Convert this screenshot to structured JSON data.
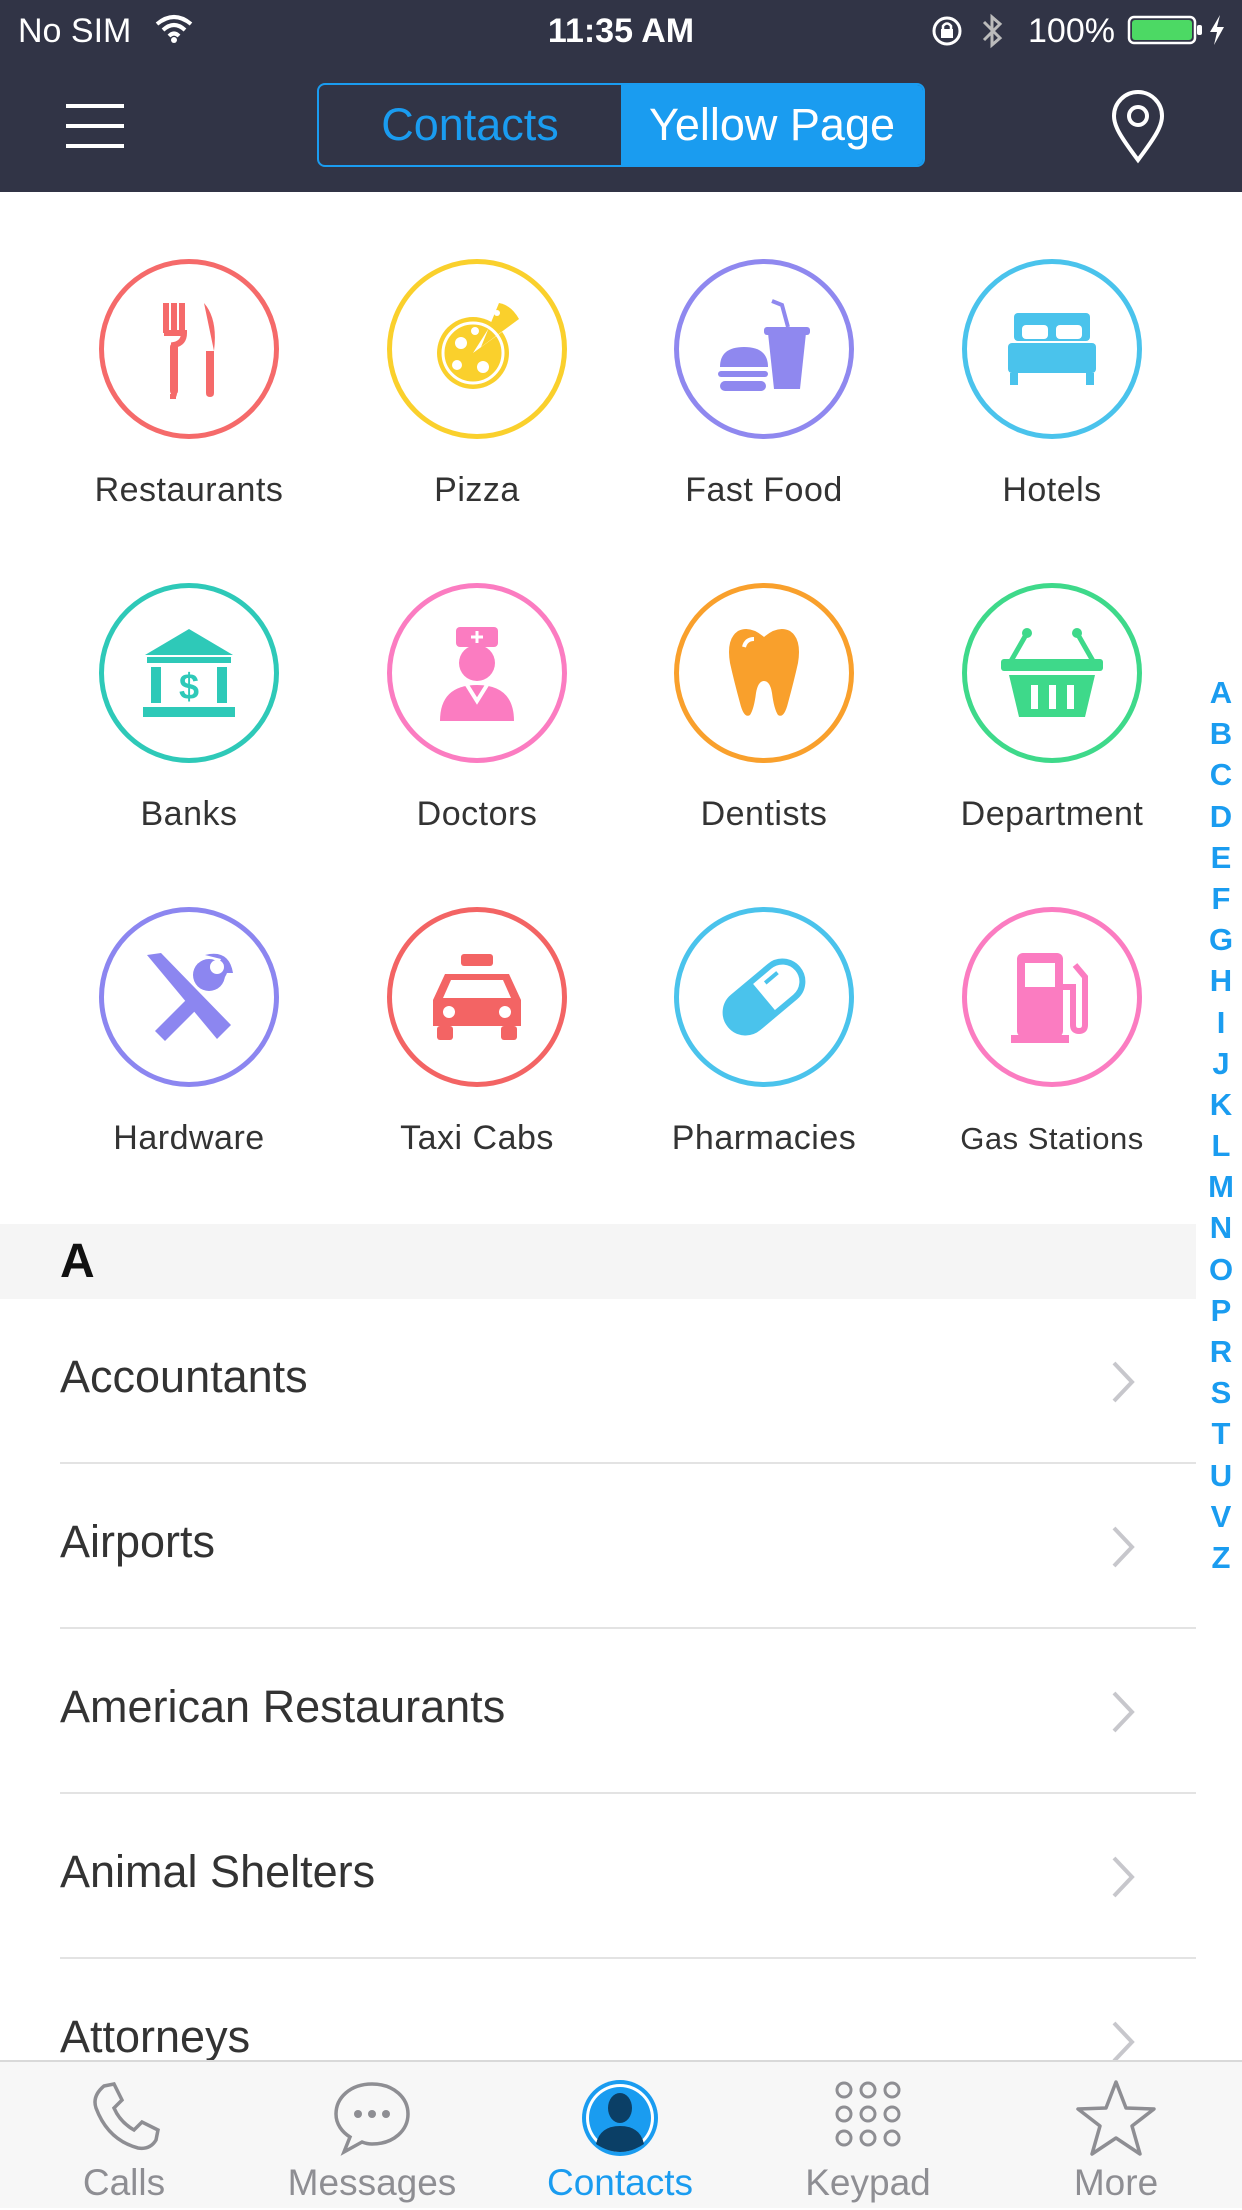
{
  "status_bar": {
    "carrier": "No SIM",
    "time": "11:35 AM",
    "battery": "100%"
  },
  "header": {
    "segments": [
      {
        "label": "Contacts",
        "selected": false
      },
      {
        "label": "Yellow Page",
        "selected": true
      }
    ]
  },
  "categories": [
    {
      "label": "Restaurants",
      "icon": "fork-knife-icon",
      "color": "#f56a6a"
    },
    {
      "label": "Pizza",
      "icon": "pizza-icon",
      "color": "#fad02c"
    },
    {
      "label": "Fast Food",
      "icon": "burger-drink-icon",
      "color": "#8f88ef"
    },
    {
      "label": "Hotels",
      "icon": "bed-icon",
      "color": "#4ac3ec"
    },
    {
      "label": "Banks",
      "icon": "bank-icon",
      "color": "#2ec9b8"
    },
    {
      "label": "Doctors",
      "icon": "nurse-icon",
      "color": "#fb7cc1"
    },
    {
      "label": "Dentists",
      "icon": "tooth-icon",
      "color": "#f9a02c"
    },
    {
      "label": "Department",
      "icon": "basket-icon",
      "color": "#3ed98a"
    },
    {
      "label": "Hardware",
      "icon": "tools-icon",
      "color": "#8c86f0"
    },
    {
      "label": "Taxi Cabs",
      "icon": "taxi-icon",
      "color": "#f36464"
    },
    {
      "label": "Pharmacies",
      "icon": "pill-icon",
      "color": "#4ac3ec"
    },
    {
      "label": "Gas Stations",
      "icon": "gas-pump-icon",
      "color": "#fb7cc1"
    }
  ],
  "index_letters": [
    "A",
    "B",
    "C",
    "D",
    "E",
    "F",
    "G",
    "H",
    "I",
    "J",
    "K",
    "L",
    "M",
    "N",
    "O",
    "P",
    "R",
    "S",
    "T",
    "U",
    "V",
    "Z"
  ],
  "section": {
    "letter": "A"
  },
  "list_items": [
    "Accountants",
    "Airports",
    "American Restaurants",
    "Animal Shelters",
    "Attorneys"
  ],
  "tabs": [
    {
      "label": "Calls",
      "icon": "phone-icon",
      "active": false
    },
    {
      "label": "Messages",
      "icon": "chat-bubble-icon",
      "active": false
    },
    {
      "label": "Contacts",
      "icon": "person-icon",
      "active": true
    },
    {
      "label": "Keypad",
      "icon": "keypad-icon",
      "active": false
    },
    {
      "label": "More",
      "icon": "star-icon",
      "active": false
    }
  ],
  "colors": {
    "accent": "#1a9cf0",
    "header_bg": "#313446",
    "tab_inactive": "#8e8e93"
  }
}
